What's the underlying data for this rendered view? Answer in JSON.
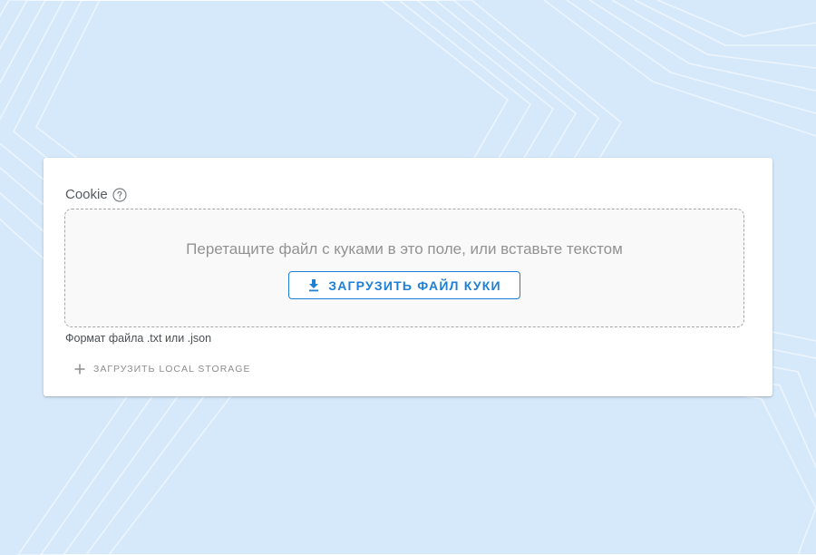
{
  "cookie_field": {
    "label": "Cookie",
    "help_icon": "question-circle-icon"
  },
  "dropzone": {
    "prompt": "Перетащите файл с куками в это поле, или вставьте текстом",
    "upload_button_label": "ЗАГРУЗИТЬ ФАЙЛ КУКИ",
    "upload_icon": "download-icon"
  },
  "hint": "Формат файла .txt или .json",
  "local_storage": {
    "label": "ЗАГРУЗИТЬ LOCAL STORAGE",
    "icon": "plus-icon"
  },
  "colors": {
    "background": "#d6e9fb",
    "accent": "#1e7fd6",
    "card": "#ffffff",
    "dropzone_bg": "#f9f9f9"
  }
}
